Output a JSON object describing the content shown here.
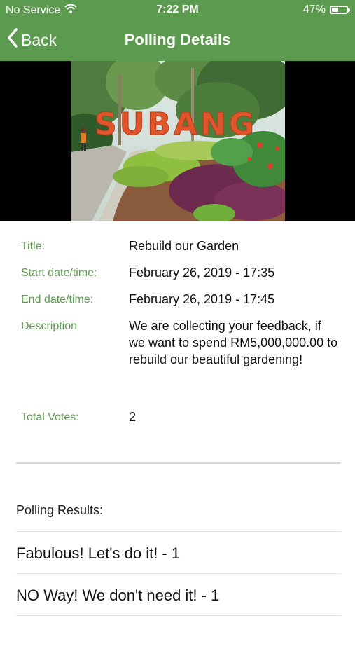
{
  "status_bar": {
    "carrier": "No Service",
    "time": "7:22 PM",
    "battery_percent": "47%",
    "battery_level": 0.47
  },
  "nav": {
    "back_label": "Back",
    "title": "Polling Details"
  },
  "hero": {
    "sign_text": "SUBANG"
  },
  "details": {
    "title_label": "Title:",
    "title_value": "Rebuild our Garden",
    "start_label": "Start date/time:",
    "start_value": "February 26, 2019 - 17:35",
    "end_label": "End date/time:",
    "end_value": "February 26, 2019 - 17:45",
    "description_label": "Description",
    "description_value": "We are collecting your feedback, if we want to spend RM5,000,000.00 to rebuild our beautiful gardening!",
    "votes_label": "Total Votes:",
    "votes_value": "2"
  },
  "results": {
    "label": "Polling Results:",
    "items": [
      "Fabulous! Let's do it! - 1",
      "NO Way! We don't need it! - 1"
    ]
  },
  "colors": {
    "brand_green": "#5c9a4f",
    "label_green": "#5c9a4f"
  }
}
